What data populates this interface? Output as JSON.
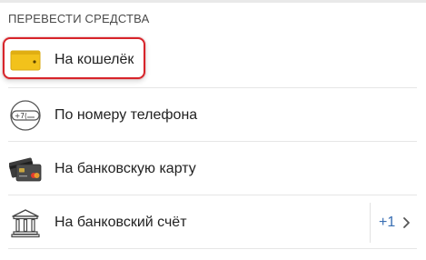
{
  "section": {
    "title": "ПЕРЕВЕСТИ СРЕДСТВА"
  },
  "items": [
    {
      "label": "На кошелёк",
      "icon": "wallet-icon",
      "highlighted": true
    },
    {
      "label": "По номеру телефона",
      "icon": "phone-number-icon",
      "icon_text": "+7(",
      "highlighted": false
    },
    {
      "label": "На банковскую карту",
      "icon": "bank-cards-icon",
      "highlighted": false
    },
    {
      "label": "На банковский счёт",
      "icon": "bank-building-icon",
      "highlighted": false,
      "count": "+1"
    }
  ],
  "colors": {
    "highlight_border": "#d7242a",
    "wallet_yellow": "#f2c21b",
    "count_blue": "#3a6fb3"
  }
}
